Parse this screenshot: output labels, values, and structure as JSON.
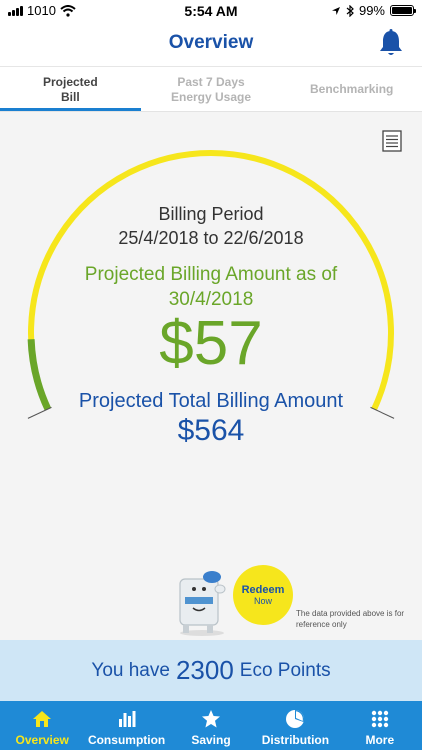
{
  "status": {
    "carrier": "1010",
    "time": "5:54 AM",
    "battery": "99%"
  },
  "header": {
    "title": "Overview"
  },
  "tabs": [
    {
      "line1": "Projected",
      "line2": "Bill"
    },
    {
      "line1": "Past 7 Days",
      "line2": "Energy Usage"
    },
    {
      "line1": "Benchmarking",
      "line2": ""
    }
  ],
  "billing": {
    "period_label": "Billing Period",
    "period_range": "25/4/2018 to 22/6/2018",
    "projected_label_line1": "Projected Billing Amount as of",
    "projected_label_line2": "30/4/2018",
    "projected_amount": "$57",
    "total_label": "Projected Total Billing Amount",
    "total_amount": "$564",
    "gauge_progress": 0.1
  },
  "redeem": {
    "line1": "Redeem",
    "line2": "Now"
  },
  "disclaimer": "The data provided above is for reference only",
  "eco": {
    "prefix": "You have",
    "points": "2300",
    "suffix": "Eco Points"
  },
  "nav": [
    {
      "label": "Overview",
      "icon": "home-icon"
    },
    {
      "label": "Consumption",
      "icon": "bar-chart-icon"
    },
    {
      "label": "Saving",
      "icon": "star-icon"
    },
    {
      "label": "Distribution",
      "icon": "pie-chart-icon"
    },
    {
      "label": "More",
      "icon": "grid-icon"
    }
  ],
  "colors": {
    "brand_blue": "#1a52a8",
    "accent_green": "#6aa629",
    "gauge_yellow": "#f6e61c",
    "nav_blue": "#1f8ad6"
  }
}
